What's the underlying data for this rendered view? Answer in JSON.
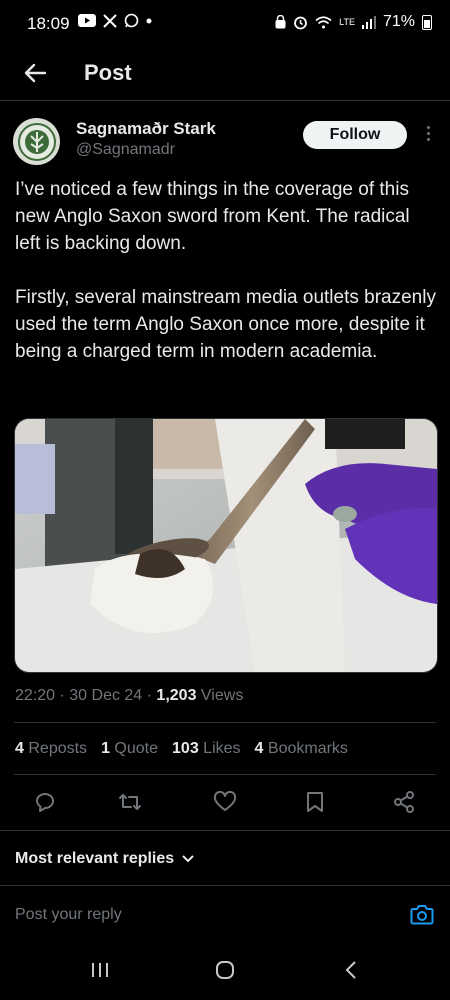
{
  "status": {
    "time": "18:09",
    "battery": "71%",
    "network": "LTE"
  },
  "header": {
    "title": "Post"
  },
  "author": {
    "name": "Sagnamaðr Stark",
    "handle": "@Sagnamadr",
    "follow_label": "Follow"
  },
  "tweet": {
    "paragraphs": [
      "I’ve noticed a few things in the coverage of this new Anglo Saxon sword from Kent. The radical left is backing down.",
      "Firstly, several mainstream media outlets brazenly used the term Anglo Saxon once more, despite it being a charged term in modern academia."
    ]
  },
  "meta": {
    "time": "22:20",
    "date": "30 Dec 24",
    "views_count": "1,203",
    "views_label": "Views"
  },
  "stats": {
    "reposts_count": "4",
    "reposts_label": "Reposts",
    "quote_count": "1",
    "quote_label": "Quote",
    "likes_count": "103",
    "likes_label": "Likes",
    "bookmarks_count": "4",
    "bookmarks_label": "Bookmarks"
  },
  "replies": {
    "sort_label": "Most relevant replies",
    "placeholder": "Post your reply"
  },
  "colors": {
    "background": "#000000",
    "text": "#e7e9ea",
    "muted": "#71767b",
    "accent": "#1d9bf0",
    "border": "#2f3336"
  }
}
